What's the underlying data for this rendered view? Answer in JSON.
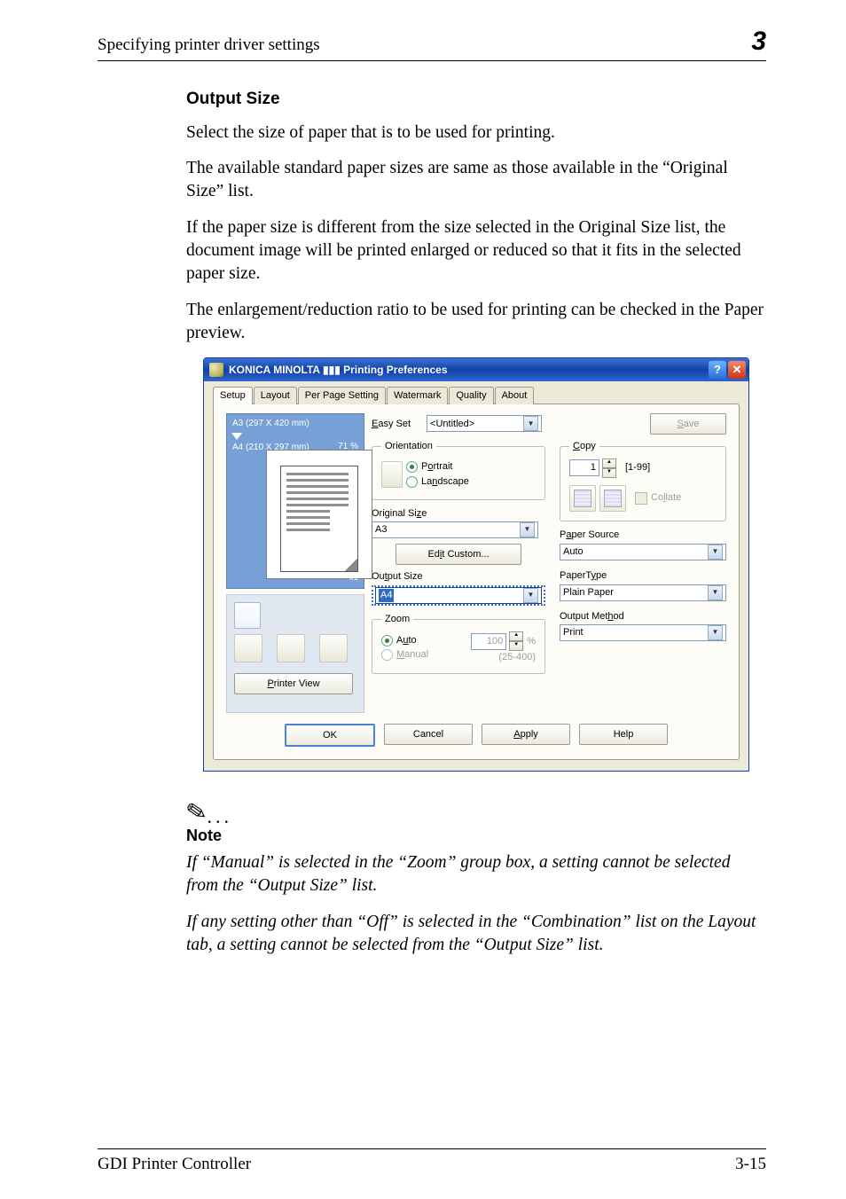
{
  "header": {
    "left": "Specifying printer driver settings",
    "right": "3"
  },
  "content": {
    "heading": "Output Size",
    "p1": "Select the size of paper that is to be used for printing.",
    "p2": "The available standard paper sizes are same as those available in the “Original Size” list.",
    "p3": "If the paper size is different from the size selected in the Original Size list, the document image will be printed enlarged or reduced so that it fits in the selected paper size.",
    "p4": "The enlargement/reduction ratio to be used for printing can be checked in the Paper preview."
  },
  "dialog": {
    "title": "KONICA MINOLTA ▮▮▮ Printing Preferences",
    "tabs": [
      "Setup",
      "Layout",
      "Per Page Setting",
      "Watermark",
      "Quality",
      "About"
    ],
    "active_tab": 0,
    "preview": {
      "line1": "A3 (297 X 420 mm)",
      "line2": "A4 (210 X 297 mm)",
      "pct": "71 %",
      "x1": "x1"
    },
    "printer_view": "Printer View",
    "easyset_label": "Easy Set",
    "easyset_value": "<Untitled>",
    "save": "Save",
    "orientation": {
      "legend": "Orientation",
      "portrait": "Portrait",
      "landscape": "Landscape"
    },
    "original_size": {
      "label": "Original Size",
      "value": "A3",
      "edit_custom": "Edit Custom..."
    },
    "output_size": {
      "label": "Output Size",
      "value": "A4"
    },
    "zoom": {
      "legend": "Zoom",
      "auto": "Auto",
      "manual": "Manual",
      "value": "100",
      "unit": "%",
      "range": "(25-400)"
    },
    "copy": {
      "legend": "Copy",
      "value": "1",
      "range": "[1-99]",
      "collate": "Collate"
    },
    "paper_source": {
      "label": "Paper Source",
      "value": "Auto"
    },
    "paper_type": {
      "label": "PaperType",
      "value": "Plain Paper"
    },
    "output_method": {
      "label": "Output Method",
      "value": "Print"
    },
    "buttons": {
      "ok": "OK",
      "cancel": "Cancel",
      "apply": "Apply",
      "help": "Help"
    }
  },
  "note": {
    "title": "Note",
    "body1": "If “Manual” is selected in the “Zoom” group box, a setting cannot be selected from the “Output Size” list.",
    "body2": "If any setting other than “Off” is selected in the “Combination” list on the Layout tab, a setting cannot be selected from the “Output Size” list."
  },
  "footer": {
    "left": "GDI Printer Controller",
    "right": "3-15"
  }
}
